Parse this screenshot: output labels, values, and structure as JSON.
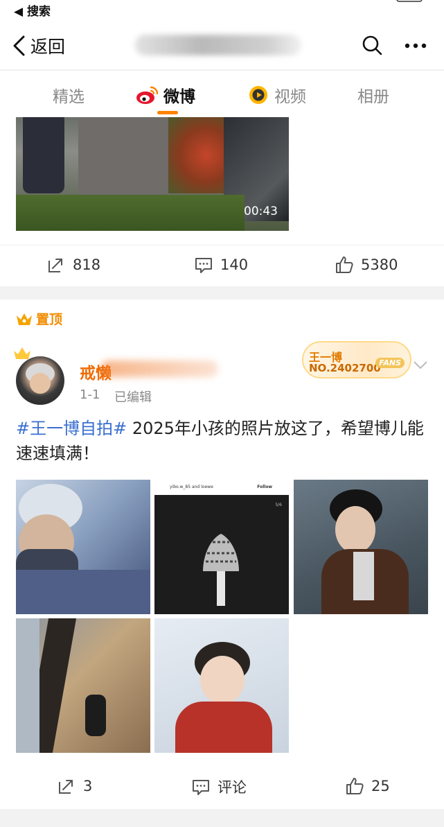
{
  "status_bar": {
    "back_app": "◀ 搜索"
  },
  "topbar": {
    "back_label": "返回"
  },
  "tabs": [
    {
      "label": "精选",
      "active": false
    },
    {
      "label": "微博",
      "active": true
    },
    {
      "label": "视频",
      "active": false
    },
    {
      "label": "相册",
      "active": false
    }
  ],
  "post1": {
    "video_duration": "00:43",
    "reposts": "818",
    "comments": "140",
    "likes": "5380"
  },
  "post2": {
    "pinned_label": "置顶",
    "username_visible": "戒懒",
    "time": "1-1",
    "edited": "已编辑",
    "fans_badge": {
      "name": "王一博",
      "number": "NO.2402700",
      "tag": "FANS"
    },
    "text_tag": "#王一博自拍#",
    "text_body": " 2025年小孩的照片放这了，希望博儿能速速填满！",
    "photo2": {
      "user": "yibo.w_85 and loewe",
      "follow": "Follow",
      "page": "5/6"
    },
    "reposts": "3",
    "comments": "评论",
    "likes": "25"
  },
  "colors": {
    "accent": "#ff8200",
    "hashtag": "#3a6fd0",
    "username": "#f06a00",
    "pinned": "#f28c00"
  }
}
